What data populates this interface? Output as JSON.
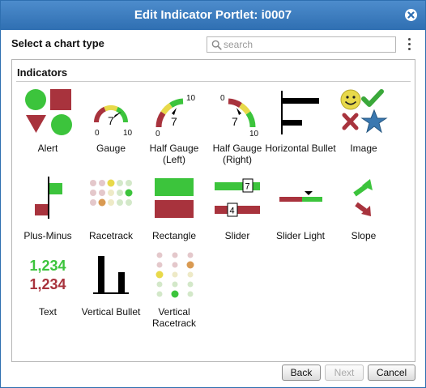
{
  "dialog": {
    "title": "Edit Indicator Portlet: i0007"
  },
  "header": {
    "subtitle": "Select a chart type"
  },
  "search": {
    "placeholder": "search",
    "value": ""
  },
  "panel": {
    "heading": "Indicators"
  },
  "indicators": [
    {
      "label": "Alert"
    },
    {
      "label": "Gauge",
      "min": "0",
      "value": "7",
      "max": "10"
    },
    {
      "label": "Half Gauge (Left)",
      "min": "0",
      "value": "7",
      "max": "10"
    },
    {
      "label": "Half Gauge (Right)",
      "min": "0",
      "value": "7",
      "max": "10"
    },
    {
      "label": "Horizontal Bullet"
    },
    {
      "label": "Image"
    },
    {
      "label": "Plus-Minus"
    },
    {
      "label": "Racetrack"
    },
    {
      "label": "Rectangle"
    },
    {
      "label": "Slider",
      "value_top": "7",
      "value_bottom": "4"
    },
    {
      "label": "Slider Light"
    },
    {
      "label": "Slope"
    },
    {
      "label": "Text",
      "value_top": "1,234",
      "value_bottom": "1,234"
    },
    {
      "label": "Vertical Bullet"
    },
    {
      "label": "Vertical Racetrack"
    }
  ],
  "buttons": {
    "back": "Back",
    "next": "Next",
    "cancel": "Cancel"
  },
  "colors": {
    "title_bar": "#3a7bbf",
    "green": "#3cc43c",
    "red": "#a8333d",
    "yellow": "#e8d94a",
    "blue": "#3a78b0"
  }
}
